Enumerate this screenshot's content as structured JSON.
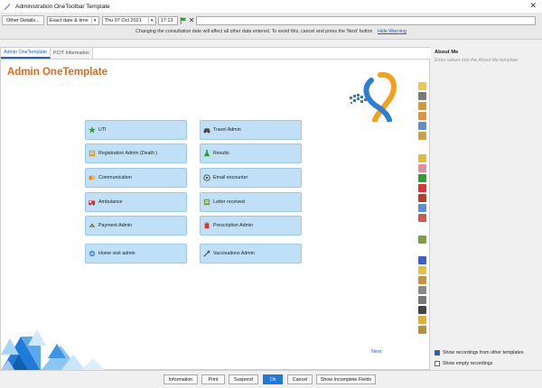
{
  "window": {
    "title": "Administration OneToolbar Template"
  },
  "toolbar": {
    "other_details": "Other Details...",
    "date_mode": "Exact date & time",
    "date": "Thu 07 Oct 2021",
    "time": "17:13",
    "notice": "Changing the consultation date will affect all other data entered. To avoid this, cancel and press the 'Next' button",
    "hide_warning": "Hide Warning"
  },
  "tabs": [
    {
      "label": "Admin OneTemplate",
      "active": true
    },
    {
      "label": "PCIT Information",
      "active": false
    }
  ],
  "canvas": {
    "title": "Admin OneTemplate",
    "tiles_left": [
      "UTI",
      "Registration Admin (Death )",
      "Communication",
      "Ambulance",
      "Payment Admin",
      "Home visit admin"
    ],
    "tiles_right": [
      "Travel Admin",
      "Results",
      "Email encounter",
      "Letter received",
      "Prescription Admin",
      "Vaccinations Admin"
    ],
    "next_label": "Next"
  },
  "right_panel": {
    "header": "About Me",
    "subtitle": "Enter values into the About Me template",
    "chk_other": "Show recordings from other templates",
    "chk_empty": "Show empty recordings",
    "chk_other_checked": true,
    "chk_empty_checked": false
  },
  "footer": {
    "information": "Information",
    "print": "Print",
    "suspend": "Suspend",
    "ok": "Ok",
    "cancel": "Cancel",
    "show_incomplete": "Show Incomplete Fields"
  },
  "colors": {
    "accent": "#1f7ad9",
    "title_orange": "#e06a1b",
    "tile_bg": "#bfe0f7"
  }
}
